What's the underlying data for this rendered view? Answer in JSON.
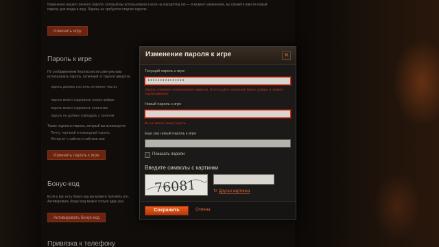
{
  "background": {
    "intro_text": "Изменение вашего личного пароля, который вы использовали в игре на wargaming.net — в момент изменения, вы сможете ввести новый пароль для входа в игру. Пароль не требуется старого пароля.",
    "change_game_button": "Изменить игру",
    "password_heading": "Пароль к игре",
    "password_text": "По соображениям безопасности советуем вам использовать пароль, отличный от пароля аккаунта. Использовать можно латинские буквы:",
    "bullets": [
      "пароль должен состоять не менее чем из",
      "пароль может содержать только цифры",
      "пароль может содержать латинские",
      "пароль не должен совпадать с логином"
    ],
    "password_text_2": "Также отдельно пароль, который вы используете:",
    "bullets_2": [
      "Почту, торговой и командный пароль",
      "Интернет с сайтом и сайтами жив"
    ],
    "change_password_button": "Изменить пароль к игре",
    "bonus_heading": "Бонус-код",
    "bonus_text": "Если у вас есть бонус-код вы можете получить его. Активировать бонус-код можно только один раз.",
    "bonus_button": "Активировать бонус-код",
    "bottom_heading": "Привязка к телефону"
  },
  "modal": {
    "title": "Изменение пароля к игре",
    "current_password_label": "Текущий пароль к игре",
    "current_password_value": "•••••••••••••••",
    "current_password_error": "Пароль содержит непрерывные символы. Используйте латинские буквы, цифры и символ подчёркивания.",
    "new_password_label": "Новый пароль к игре",
    "new_password_value": "",
    "new_password_error": "Вы не ввели новый пароль",
    "repeat_password_label": "Еще раз новый пароль к игре",
    "repeat_password_value": "",
    "show_passwords_label": "Показать пароли",
    "captcha_title": "Введите символы с картинки",
    "captcha_text": "76081",
    "captcha_value": "",
    "refresh_label": "Другая картинка",
    "save_label": "Сохранить",
    "cancel_label": "Отмена",
    "close_glyph": "✕",
    "refresh_glyph": "↻"
  },
  "colors": {
    "accent": "#e0623a",
    "error": "#d8301c",
    "button": "#d94d17"
  }
}
